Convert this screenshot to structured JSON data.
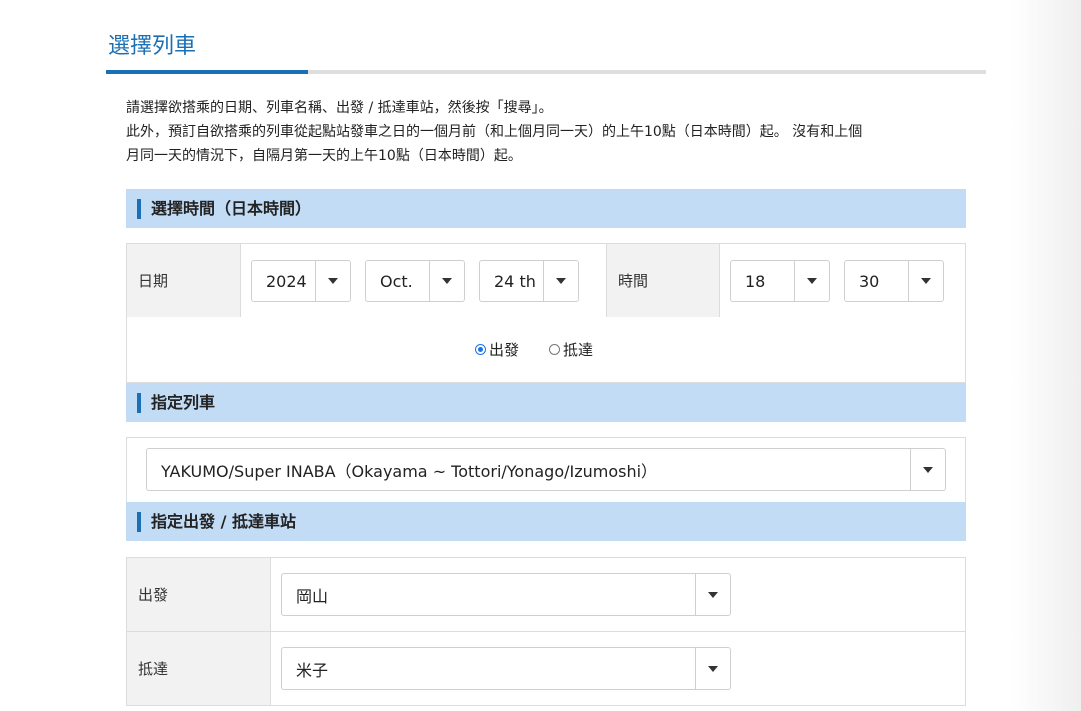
{
  "page_title": "選擇列車",
  "intro": {
    "line1": "請選擇欲搭乘的日期、列車名稱、出發 / 抵達車站，然後按「搜尋」。",
    "line2": "此外，預訂自欲搭乘的列車從起點站發車之日的一個月前（和上個月同一天）的上午10點（日本時間）起。 沒有和上個",
    "line3": "月同一天的情況下，自隔月第一天的上午10點（日本時間）起。"
  },
  "time_section": {
    "heading": "選擇時間（日本時間）",
    "date_label": "日期",
    "year": "2024",
    "month": "Oct.",
    "day": "24 th",
    "time_label": "時間",
    "hour": "18",
    "minute": "30",
    "radio_depart": "出發",
    "radio_arrive": "抵達",
    "selected_radio": "出發"
  },
  "train_section": {
    "heading": "指定列車",
    "train_value": "YAKUMO/Super INABA（Okayama ~ Tottori/Yonago/Izumoshi）"
  },
  "station_section": {
    "heading": "指定出發 / 抵達車站",
    "depart_label": "出發",
    "depart_value": "岡山",
    "arrive_label": "抵達",
    "arrive_value": "米子"
  },
  "icons": {
    "dropdown": "caret-down-icon",
    "section_marker": "blue-bar"
  },
  "colors": {
    "accent": "#1a6fb5",
    "section_bg": "#c2dcf5",
    "label_bg": "#f2f2f2"
  }
}
